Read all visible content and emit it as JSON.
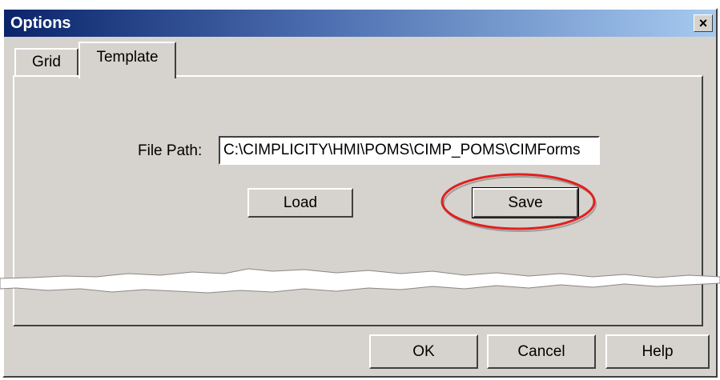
{
  "window": {
    "title": "Options",
    "close_glyph": "×"
  },
  "tabs": [
    {
      "label": "Grid",
      "selected": false
    },
    {
      "label": "Template",
      "selected": true
    }
  ],
  "template_tab": {
    "file_path_label": "File Path:",
    "file_path_value": "C:\\CIMPLICITY\\HMI\\POMS\\CIMP_POMS\\CIMForms",
    "load_label": "Load",
    "save_label": "Save"
  },
  "footer": {
    "ok_label": "OK",
    "cancel_label": "Cancel",
    "help_label": "Help"
  },
  "annotation": {
    "highlight_color": "#e02020",
    "highlighted": "Save"
  }
}
